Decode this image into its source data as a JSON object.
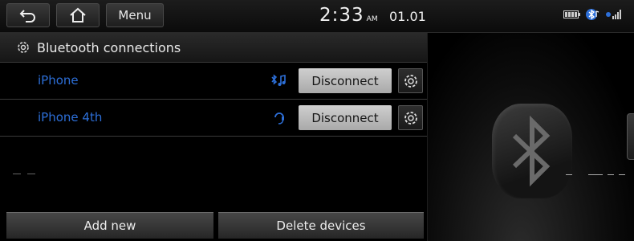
{
  "topbar": {
    "menu_label": "Menu",
    "time": "2:33",
    "ampm": "AM",
    "date": "01.01"
  },
  "header": {
    "title": "Bluetooth connections"
  },
  "devices": [
    {
      "name": "iPhone",
      "status_icon": "bluetooth-audio-icon",
      "button": "Disconnect"
    },
    {
      "name": "iPhone 4th",
      "status_icon": "headset-icon",
      "button": "Disconnect"
    }
  ],
  "actions": {
    "add_new": "Add new",
    "delete_devices": "Delete devices"
  },
  "colors": {
    "device_name": "#2d6fd8",
    "background": "#000000",
    "button_light": "#bdbdbd"
  }
}
